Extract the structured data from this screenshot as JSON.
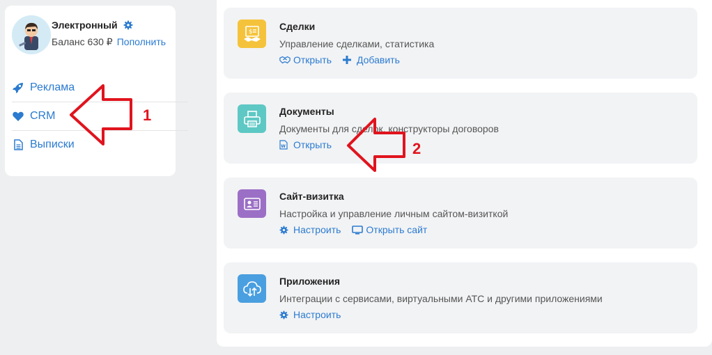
{
  "profile": {
    "name": "Электронный",
    "balance_label": "Баланс 630 ₽",
    "topup_label": "Пополнить"
  },
  "menu": {
    "items": [
      {
        "label": "Реклама",
        "icon": "rocket-icon"
      },
      {
        "label": "CRM",
        "icon": "heart-icon"
      },
      {
        "label": "Выписки",
        "icon": "document-icon"
      }
    ]
  },
  "services": [
    {
      "title": "Сделки",
      "description": "Управление сделками, статистика",
      "icon": "deals-icon",
      "color": "#f5c33b",
      "actions": [
        {
          "label": "Открыть",
          "icon": "handshake-icon"
        },
        {
          "label": "Добавить",
          "icon": "plus-icon"
        }
      ]
    },
    {
      "title": "Документы",
      "description": "Документы для сделок, конструкторы договоров",
      "icon": "printer-icon",
      "color": "#5ec8c4",
      "actions": [
        {
          "label": "Открыть",
          "icon": "word-file-icon"
        }
      ]
    },
    {
      "title": "Сайт-визитка",
      "description": "Настройка и управление личным сайтом-визиткой",
      "icon": "id-card-icon",
      "color": "#9b6fc6",
      "actions": [
        {
          "label": "Настроить",
          "icon": "gear-icon"
        },
        {
          "label": "Открыть сайт",
          "icon": "monitor-icon"
        }
      ]
    },
    {
      "title": "Приложения",
      "description": "Интеграции с сервисами, виртуальными АТС и другими приложениями",
      "icon": "cloud-icon",
      "color": "#4a9fe0",
      "actions": [
        {
          "label": "Настроить",
          "icon": "gear-icon"
        }
      ]
    }
  ],
  "annotations": {
    "arrow1_number": "1",
    "arrow2_number": "2",
    "color": "#e0141e"
  }
}
